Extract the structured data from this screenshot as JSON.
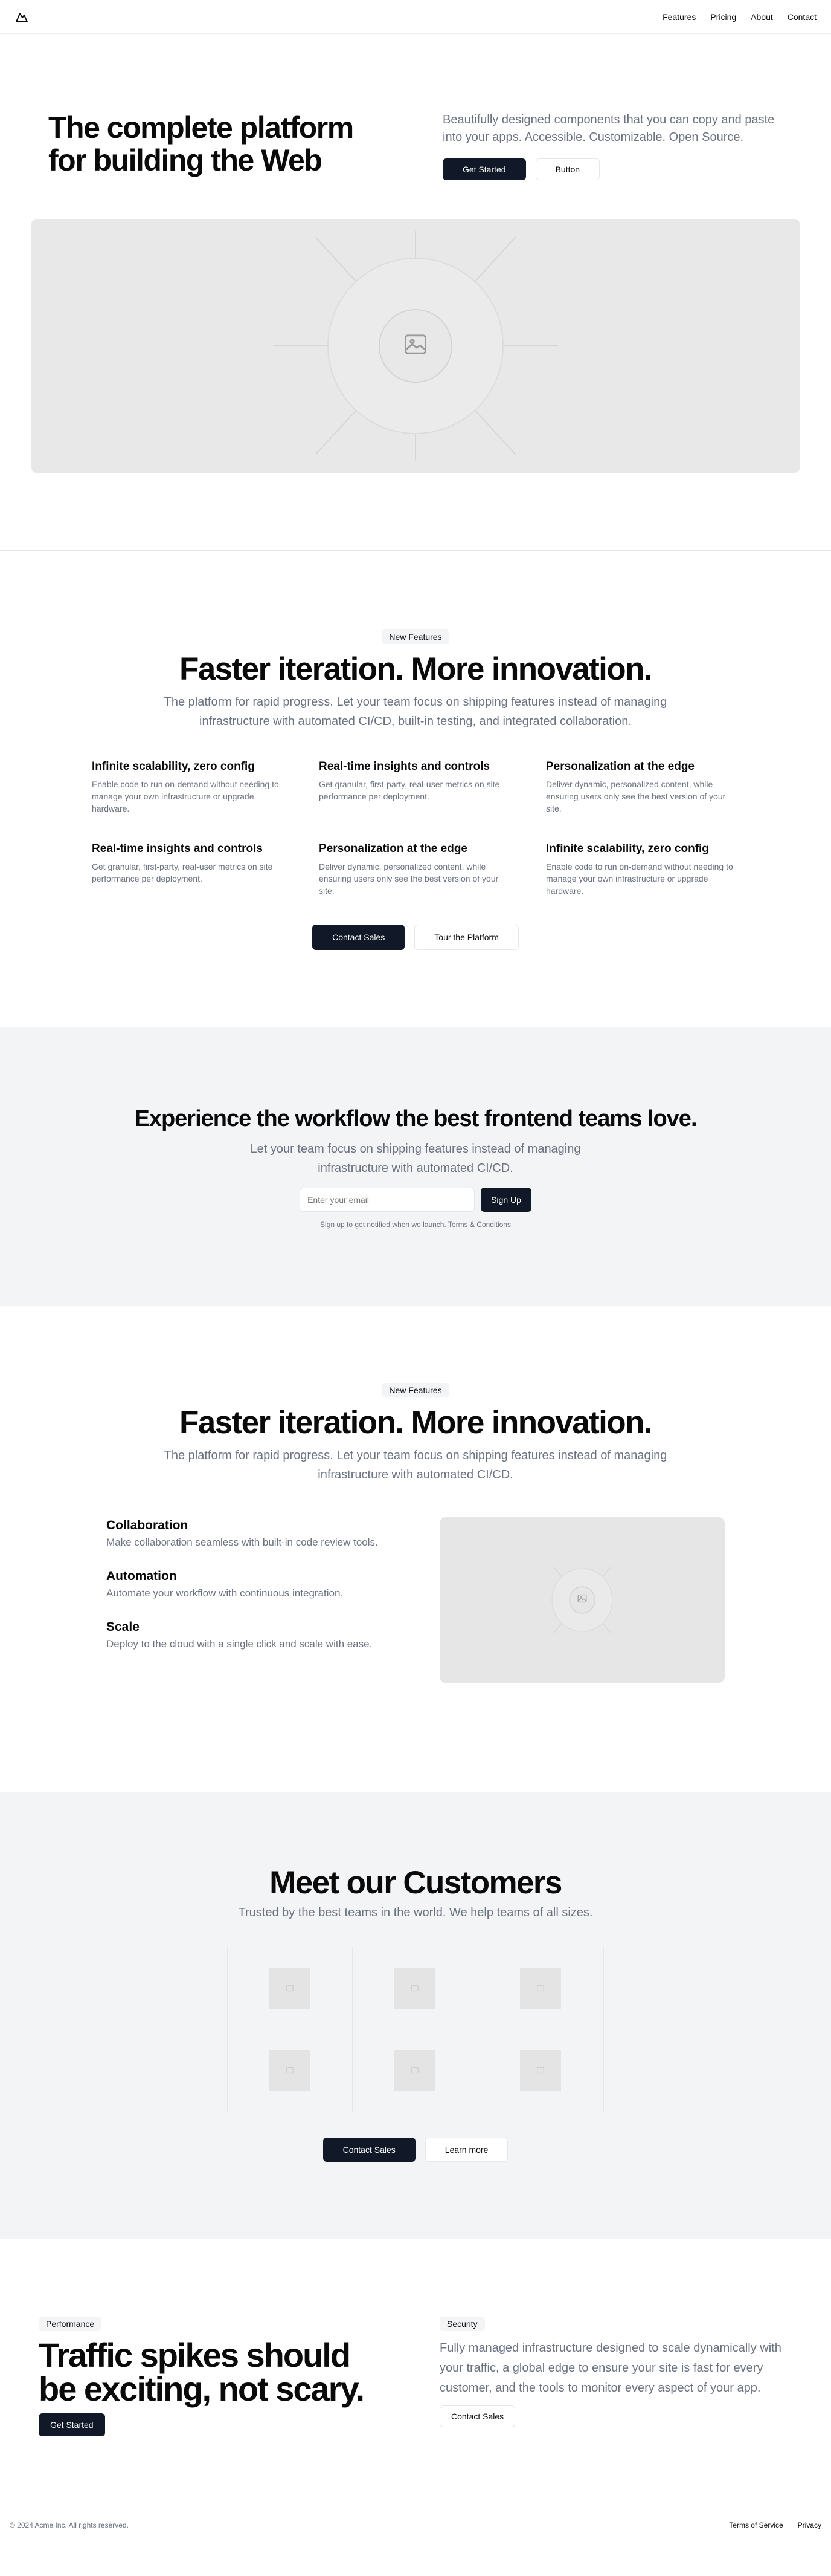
{
  "header": {
    "logo_icon": "mountain-logo-icon",
    "nav": [
      "Features",
      "Pricing",
      "About",
      "Contact"
    ]
  },
  "hero": {
    "title": "The complete platform for building the Web",
    "description": "Beautifully designed components that you can copy and paste into your apps. Accessible. Customizable. Open Source.",
    "primary_button": "Get Started",
    "secondary_button": "Button",
    "image_icon": "image-placeholder-icon"
  },
  "features": {
    "badge": "New Features",
    "title": "Faster iteration. More innovation.",
    "description": "The platform for rapid progress. Let your team focus on shipping features instead of managing infrastructure with automated CI/CD, built-in testing, and integrated collaboration.",
    "items": [
      {
        "title": "Infinite scalability, zero config",
        "text": "Enable code to run on-demand without needing to manage your own infrastructure or upgrade hardware."
      },
      {
        "title": "Real-time insights and controls",
        "text": "Get granular, first-party, real-user metrics on site performance per deployment."
      },
      {
        "title": "Personalization at the edge",
        "text": "Deliver dynamic, personalized content, while ensuring users only see the best version of your site."
      },
      {
        "title": "Real-time insights and controls",
        "text": "Get granular, first-party, real-user metrics on site performance per deployment."
      },
      {
        "title": "Personalization at the edge",
        "text": "Deliver dynamic, personalized content, while ensuring users only see the best version of your site."
      },
      {
        "title": "Infinite scalability, zero config",
        "text": "Enable code to run on-demand without needing to manage your own infrastructure or upgrade hardware."
      }
    ],
    "primary_button": "Contact Sales",
    "secondary_button": "Tour the Platform"
  },
  "signup": {
    "title": "Experience the workflow the best frontend teams love.",
    "description": "Let your team focus on shipping features instead of managing infrastructure with automated CI/CD.",
    "email_placeholder": "Enter your email",
    "button": "Sign Up",
    "note": "Sign up to get notified when we launch.",
    "terms_link": "Terms & Conditions"
  },
  "collab": {
    "badge": "New Features",
    "title": "Faster iteration. More innovation.",
    "description": "The platform for rapid progress. Let your team focus on shipping features instead of managing infrastructure with automated CI/CD.",
    "items": [
      {
        "title": "Collaboration",
        "text": "Make collaboration seamless with built-in code review tools."
      },
      {
        "title": "Automation",
        "text": "Automate your workflow with continuous integration."
      },
      {
        "title": "Scale",
        "text": "Deploy to the cloud with a single click and scale with ease."
      }
    ],
    "image_icon": "image-placeholder-icon"
  },
  "customers": {
    "title": "Meet our Customers",
    "description": "Trusted by the best teams in the world. We help teams of all sizes.",
    "logo_icons": [
      "placeholder-logo-icon",
      "placeholder-logo-icon",
      "placeholder-logo-icon",
      "placeholder-logo-icon",
      "placeholder-logo-icon",
      "placeholder-logo-icon"
    ],
    "primary_button": "Contact Sales",
    "secondary_button": "Learn more"
  },
  "performance": {
    "badge": "Performance",
    "title": "Traffic spikes should be exciting, not scary.",
    "button": "Get Started"
  },
  "security": {
    "badge": "Security",
    "description": "Fully managed infrastructure designed to scale dynamically with your traffic, a global edge to ensure your site is fast for every customer, and the tools to monitor every aspect of your app.",
    "button": "Contact Sales"
  },
  "footer": {
    "copyright": "© 2024 Acme Inc. All rights reserved.",
    "links": [
      "Terms of Service",
      "Privacy"
    ]
  }
}
